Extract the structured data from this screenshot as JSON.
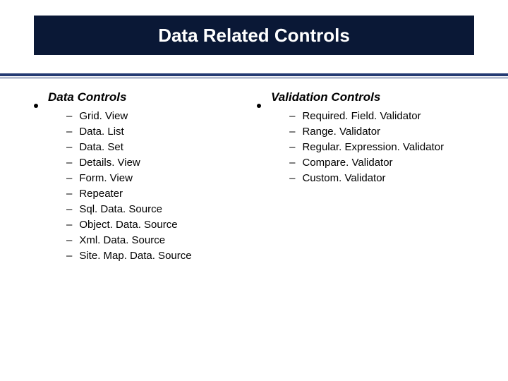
{
  "title": "Data Related Controls",
  "columns": [
    {
      "heading": "Data Controls",
      "items": [
        "Grid. View",
        "Data. List",
        "Data. Set",
        "Details. View",
        "Form. View",
        "Repeater",
        "Sql. Data. Source",
        "Object. Data. Source",
        "Xml. Data. Source",
        "Site. Map. Data. Source"
      ]
    },
    {
      "heading": "Validation Controls",
      "items": [
        "Required. Field. Validator",
        "Range. Validator",
        "Regular. Expression. Validator",
        "Compare. Validator",
        "Custom. Validator"
      ]
    }
  ]
}
